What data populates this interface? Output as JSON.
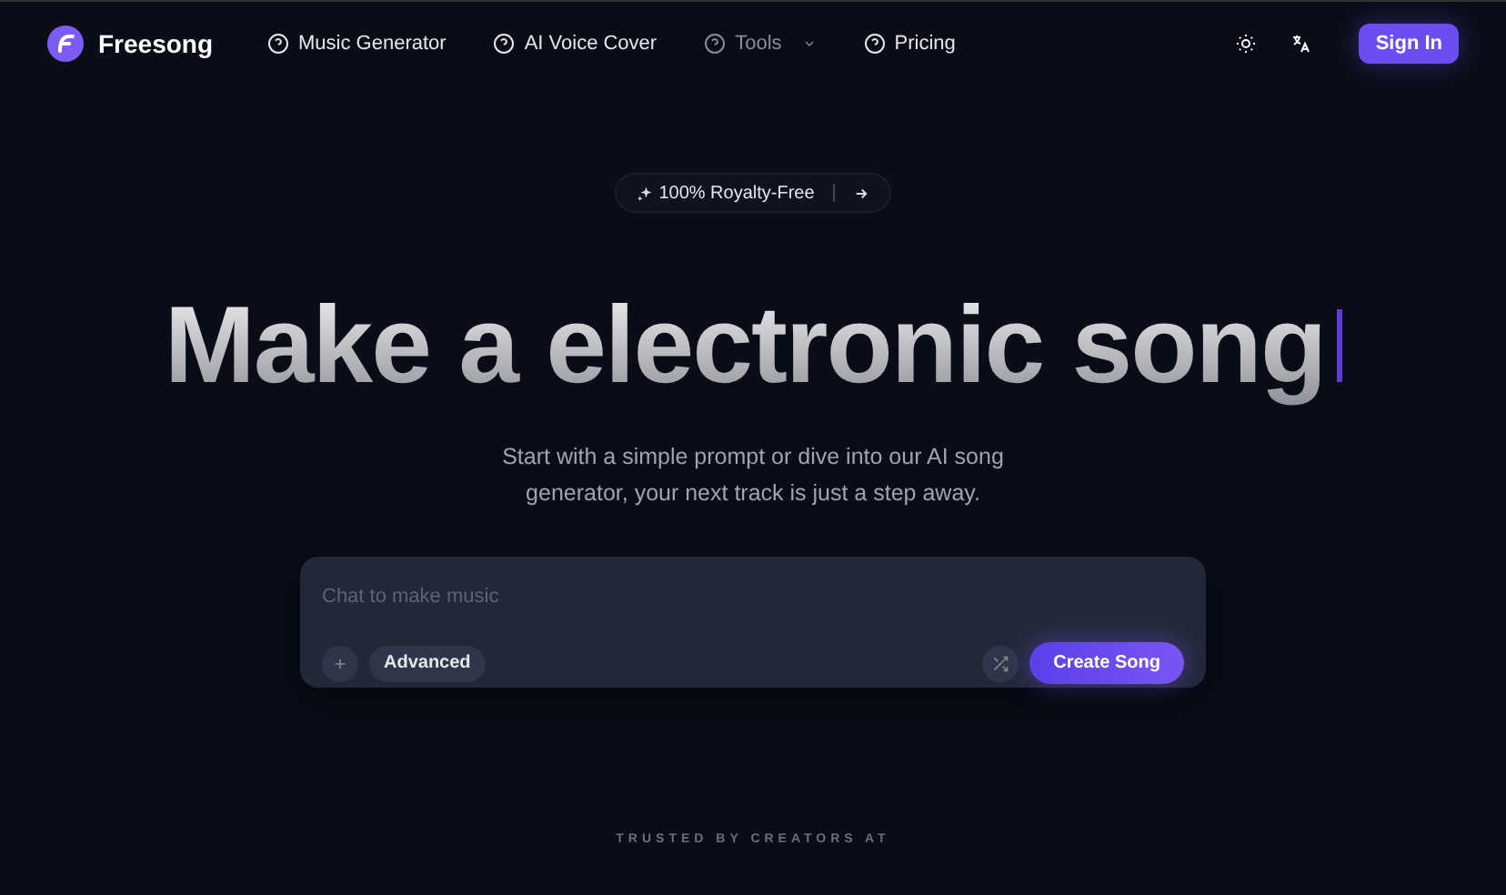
{
  "brand": {
    "name": "Freesong"
  },
  "nav": [
    {
      "label": "Music Generator",
      "disabled": false,
      "dropdown": false
    },
    {
      "label": "AI Voice Cover",
      "disabled": false,
      "dropdown": false
    },
    {
      "label": "Tools",
      "disabled": true,
      "dropdown": true
    },
    {
      "label": "Pricing",
      "disabled": false,
      "dropdown": false
    }
  ],
  "sign_in": "Sign In",
  "badge": {
    "label": "100% Royalty-Free"
  },
  "headline": "Make a electronic song",
  "subtitle": "Start with a simple prompt or dive into our AI song generator, your next track is just a step away.",
  "composer": {
    "placeholder": "Chat to make music",
    "advanced": "Advanced",
    "create": "Create Song"
  },
  "trusted": "TRUSTED BY CREATORS AT"
}
